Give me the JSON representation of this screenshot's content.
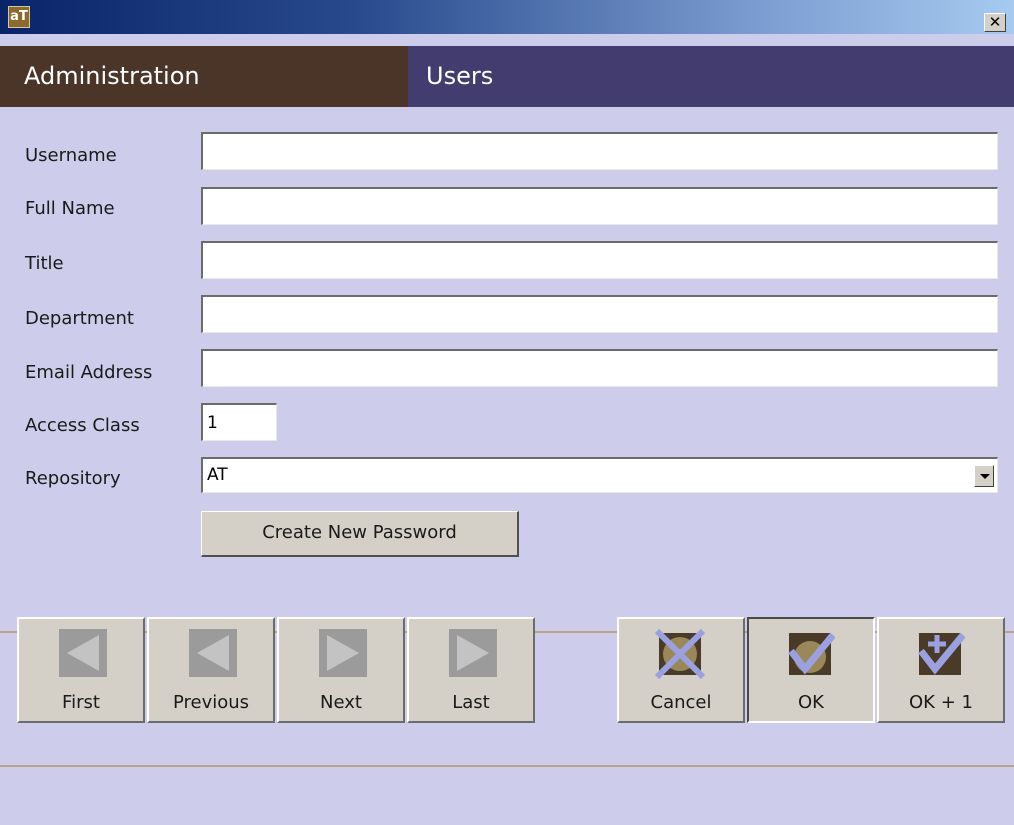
{
  "window": {
    "icon_text": "aT",
    "close_symbol": "✕"
  },
  "header": {
    "section": "Administration",
    "page": "Users"
  },
  "form": {
    "username": {
      "label": "Username",
      "value": ""
    },
    "full_name": {
      "label": "Full Name",
      "value": ""
    },
    "title": {
      "label": "Title",
      "value": ""
    },
    "department": {
      "label": "Department",
      "value": ""
    },
    "email": {
      "label": "Email Address",
      "value": ""
    },
    "access_class": {
      "label": "Access Class",
      "value": "1"
    },
    "repository": {
      "label": "Repository",
      "value": "AT"
    },
    "create_password_label": "Create New Password"
  },
  "nav": [
    {
      "label": "First",
      "icon": "arrow-left-icon"
    },
    {
      "label": "Previous",
      "icon": "arrow-left-icon"
    },
    {
      "label": "Next",
      "icon": "arrow-right-icon"
    },
    {
      "label": "Last",
      "icon": "arrow-right-icon"
    }
  ],
  "actions": [
    {
      "label": "Cancel",
      "icon": "cancel-x-icon"
    },
    {
      "label": "OK",
      "icon": "check-icon"
    },
    {
      "label": "OK + 1",
      "icon": "check-plus-icon"
    }
  ],
  "colors": {
    "background": "#cdcdeb",
    "header_left": "#4a3528",
    "header_right": "#433c6e",
    "icon_dark": "#4a3a28",
    "icon_accent": "#9aa0e0"
  }
}
